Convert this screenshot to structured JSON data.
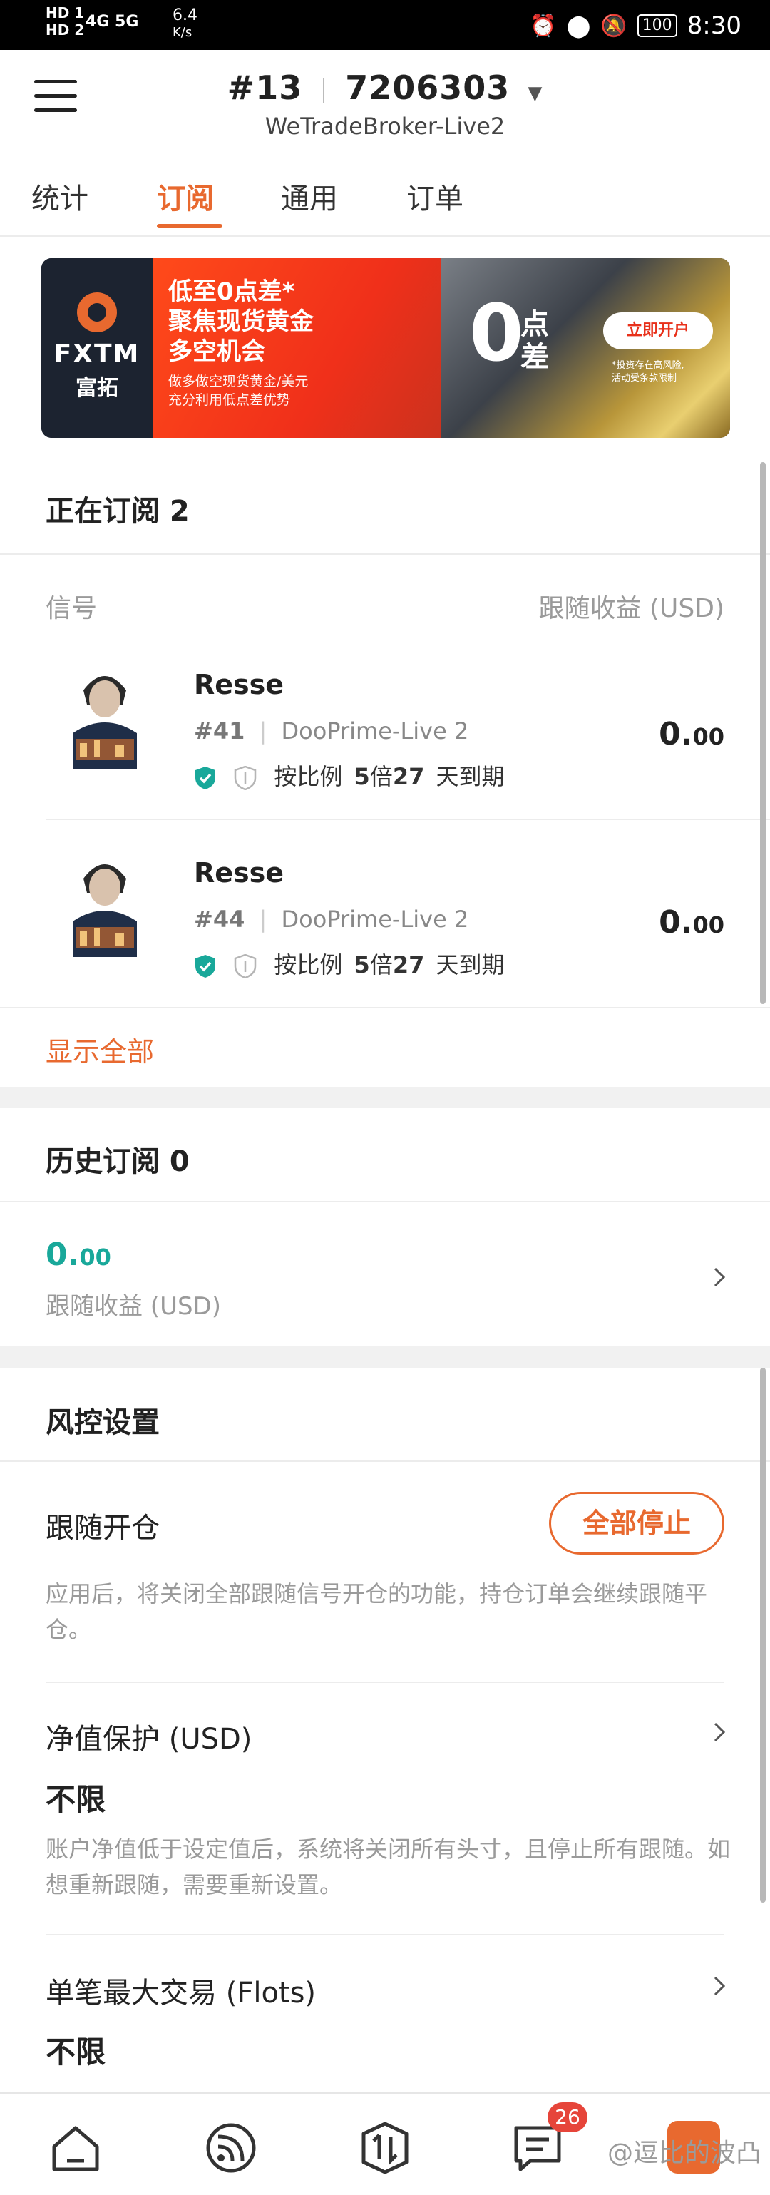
{
  "status_bar": {
    "hd1": "HD 1",
    "hd2": "HD 2",
    "signal": "4G 5G",
    "net_speed": "6.4",
    "net_unit": "K/s",
    "battery": "100",
    "time": "8:30"
  },
  "header": {
    "account_prefix": "#13",
    "account_number": "7206303",
    "server": "WeTradeBroker-Live2"
  },
  "tabs": [
    {
      "label": "统计"
    },
    {
      "label": "订阅"
    },
    {
      "label": "通用"
    },
    {
      "label": "订单"
    }
  ],
  "banner": {
    "brand_en": "FXTM",
    "brand_cn": "富拓",
    "line1": "低至0点差*",
    "line2": "聚焦现货黄金",
    "line3": "多空机会",
    "line4a": "做多做空现货黄金/美元",
    "line4b": "充分利用低点差优势",
    "zero": "0",
    "zero_cap": "点差",
    "button": "立即开户",
    "risk_line1": "*投资存在高风险,",
    "risk_line2": "活动受条款限制"
  },
  "subscriptions": {
    "title": "正在订阅 2",
    "col_signal": "信号",
    "col_profit": "跟随收益 (USD)",
    "items": [
      {
        "name": "Resse",
        "id": "#41",
        "server": "DooPrime-Live 2",
        "ratio_prefix": "按比例",
        "ratio_value": "5",
        "ratio_unit": "倍",
        "days": "27",
        "days_suffix": "天到期",
        "profit_int": "0.",
        "profit_dec": "00"
      },
      {
        "name": "Resse",
        "id": "#44",
        "server": "DooPrime-Live 2",
        "ratio_prefix": "按比例",
        "ratio_value": "5",
        "ratio_unit": "倍",
        "days": "27",
        "days_suffix": "天到期",
        "profit_int": "0.",
        "profit_dec": "00"
      }
    ],
    "show_all": "显示全部"
  },
  "history": {
    "title": "历史订阅 0",
    "profit_int": "0.",
    "profit_dec": "00",
    "profit_label": "跟随收益 (USD)"
  },
  "risk": {
    "title": "风控设置",
    "follow_open": {
      "label": "跟随开仓",
      "button": "全部停止",
      "desc": "应用后，将关闭全部跟随信号开仓的功能，持仓订单会继续跟随平仓。"
    },
    "equity": {
      "label": "净值保护 (USD)",
      "value": "不限",
      "desc": "账户净值低于设定值后，系统将关闭所有头寸，且停止所有跟随。如想重新跟随，需要重新设置。"
    },
    "max_trade": {
      "label": "单笔最大交易 (Flots)",
      "value": "不限"
    }
  },
  "bottom_nav": {
    "badge_count": "26",
    "watermark": "@逗比的波凸"
  },
  "colors": {
    "accent": "#e8692f",
    "teal": "#19a89a",
    "text": "#222222",
    "muted": "#9a9a9a"
  }
}
